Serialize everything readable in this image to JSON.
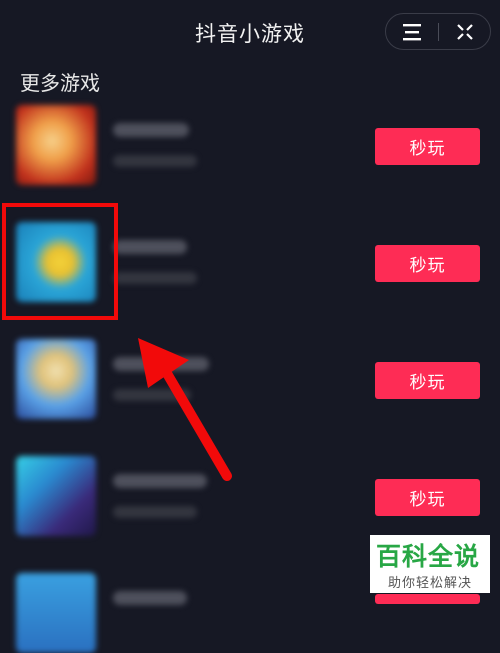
{
  "header": {
    "title": "抖音小游戏",
    "menu_icon": "menu-icon",
    "close_icon": "close-icon"
  },
  "section": {
    "title": "更多游戏"
  },
  "games": [
    {
      "play_label": "秒玩",
      "thumb_colors": [
        "#f0a04a",
        "#c0301c"
      ]
    },
    {
      "play_label": "秒玩",
      "thumb_colors": [
        "#2aa6d8",
        "#f3d23a"
      ]
    },
    {
      "play_label": "秒玩",
      "thumb_colors": [
        "#5aa2e8",
        "#e0c27a"
      ]
    },
    {
      "play_label": "秒玩",
      "thumb_colors": [
        "#36d0e6",
        "#3a2a7a"
      ]
    }
  ],
  "annotation": {
    "highlight_color": "#f20a0a",
    "arrow_color": "#f20a0a"
  },
  "watermark": {
    "main": "百科全说",
    "sub": "助你轻松解决"
  },
  "colors": {
    "accent": "#fe2c55",
    "background": "#161824"
  }
}
